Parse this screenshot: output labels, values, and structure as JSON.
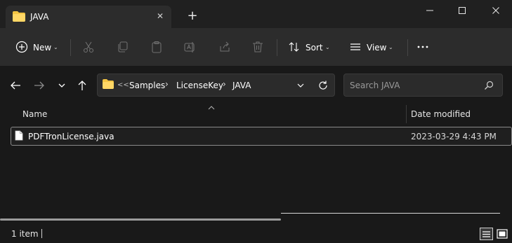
{
  "tab": {
    "title": "JAVA"
  },
  "toolbar": {
    "new_label": "New",
    "sort_label": "Sort",
    "view_label": "View"
  },
  "breadcrumb": {
    "overflow": "<<",
    "items": [
      "Samples",
      "LicenseKey",
      "JAVA"
    ]
  },
  "search": {
    "placeholder": "Search JAVA"
  },
  "columns": {
    "name": "Name",
    "date_modified": "Date modified"
  },
  "files": [
    {
      "name": "PDFTronLicense.java",
      "date_modified": "2023-03-29 4:43 PM"
    }
  ],
  "status": {
    "items": "1 item"
  },
  "colors": {
    "folder": "#f3c443",
    "background": "#191919",
    "toolbar": "#2c2c2c"
  }
}
